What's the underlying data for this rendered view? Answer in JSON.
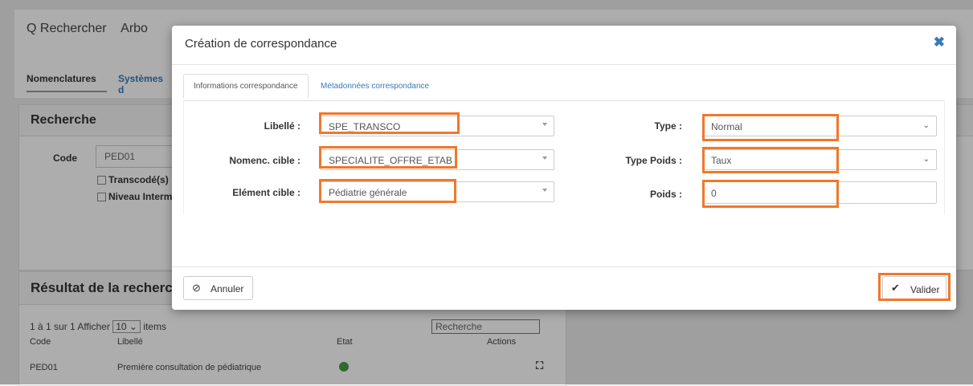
{
  "background": {
    "nav": {
      "search": "Q Rechercher",
      "tree": "Arbo"
    },
    "tabs": [
      "Nomenclatures",
      "Systèmes d"
    ],
    "search_panel": {
      "title": "Recherche",
      "code_label": "Code",
      "code_value": "PED01",
      "cb1": "Transcodé(s)",
      "cb2": "Niveau Interm"
    },
    "results_panel": {
      "title": "Résultat de la recherch",
      "paging_prefix": "1 à 1 sur 1  Afficher",
      "page_size": "10",
      "paging_suffix": "items",
      "search_placeholder": "Recherche",
      "columns": [
        "Code",
        "Libellé",
        "Etat",
        "Actions"
      ],
      "rows": [
        {
          "code": "PED01",
          "label": "Première consultation de pédiatrique"
        }
      ]
    }
  },
  "modal": {
    "title": "Création de correspondance",
    "tabs": [
      "Informations correspondance",
      "Métadonnées correspondance"
    ],
    "fields": {
      "libelle_label": "Libellé :",
      "libelle_value": "SPE_TRANSCO",
      "nomenc_label": "Nomenc. cible :",
      "nomenc_value": "SPECIALITE_OFFRE_ETAB",
      "element_label": "Elément cible :",
      "element_value": "Pédiatrie générale",
      "type_label": "Type :",
      "type_value": "Normal",
      "type_poids_label": "Type Poids :",
      "type_poids_value": "Taux",
      "poids_label": "Poids :",
      "poids_value": "0"
    },
    "buttons": {
      "cancel": "Annuler",
      "validate": "Valider"
    }
  },
  "colors": {
    "highlight": "#f0782b",
    "link": "#3a79b8"
  }
}
